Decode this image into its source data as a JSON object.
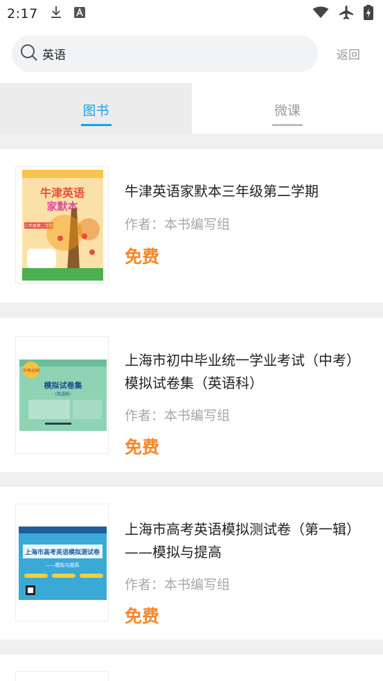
{
  "status_bar": {
    "time": "2:17",
    "icons": [
      "download-icon",
      "font-icon",
      "wifi-icon",
      "airplane-icon",
      "battery-icon"
    ]
  },
  "search": {
    "query": "英语",
    "back_label": "返回",
    "icon": "search-icon"
  },
  "tabs": [
    {
      "label": "图书",
      "active": true
    },
    {
      "label": "微课",
      "active": false
    }
  ],
  "books": [
    {
      "title": "牛津英语家默本三年级第二学期",
      "author": "作者：本书编写组",
      "price": "免费",
      "cover": {
        "banner": "牛津英语",
        "subtitle": "家默本",
        "grade": "三年级第二学期"
      }
    },
    {
      "title": "上海市初中毕业统一学业考试（中考）模拟试卷集（英语科）",
      "author": "作者：本书编写组",
      "price": "免费",
      "cover": {
        "badge": "中考必刷",
        "heading": "模拟试卷集",
        "subheading": "（英语科）"
      }
    },
    {
      "title": "上海市高考英语模拟测试卷（第一辑）——模拟与提高",
      "author": "作者：本书编写组",
      "price": "免费",
      "cover": {
        "heading": "上海市高考英语模拟测试卷",
        "subheading": "——模拟与提高"
      }
    }
  ],
  "colors": {
    "accent": "#1aa0e6",
    "price": "#f5872a",
    "muted": "#a8a8a8",
    "separator": "#f0f0f0"
  }
}
